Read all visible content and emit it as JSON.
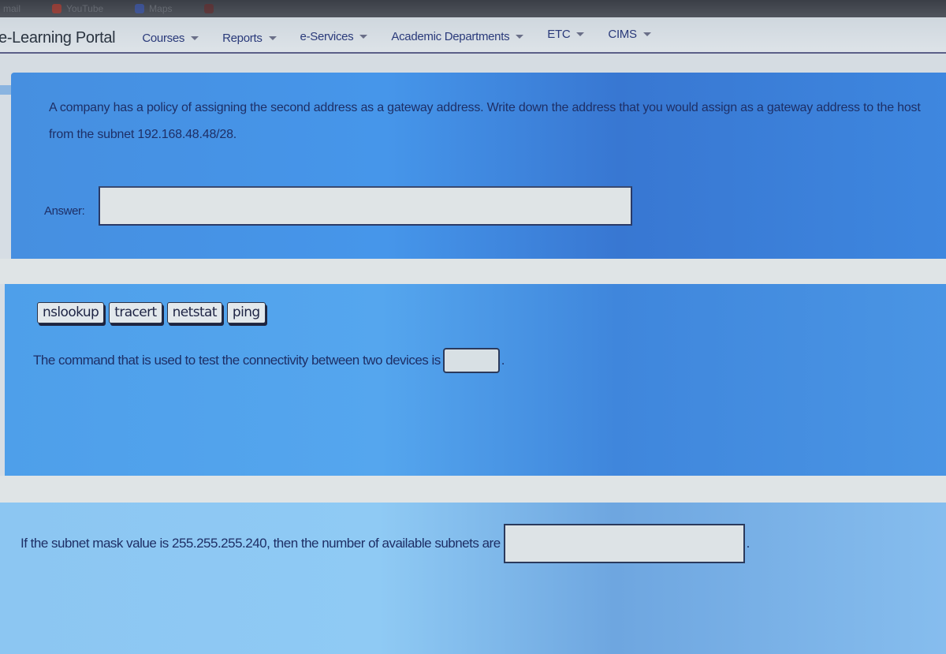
{
  "browser": {
    "bookmarks": [
      {
        "label": "mail",
        "color": "#8a8e96"
      },
      {
        "label": "YouTube",
        "color": "#c63a2a"
      },
      {
        "label": "Maps",
        "color": "#3a5ac0"
      },
      {
        "label": "",
        "color": "#6a2a2a"
      }
    ]
  },
  "navbar": {
    "brand": "e-Learning Portal",
    "items": [
      {
        "label": "Courses"
      },
      {
        "label": "Reports"
      },
      {
        "label": "e-Services"
      },
      {
        "label": "Academic Departments"
      },
      {
        "label": "ETC"
      },
      {
        "label": "CIMS"
      }
    ]
  },
  "question1": {
    "text": "A company has a policy of assigning the second address as a gateway address. Write down the address that you would assign as a gateway address to the host from the subnet 192.168.48.48/28.",
    "answer_label": "Answer:",
    "answer_value": ""
  },
  "question2": {
    "options": [
      "nslookup",
      "tracert",
      "netstat",
      "ping"
    ],
    "text": "The command that is used to test the connectivity between two devices is",
    "drop_value": "",
    "suffix": "."
  },
  "question3": {
    "text": "If the subnet mask value is 255.255.255.240, then the number of available subnets are",
    "answer_value": "",
    "suffix": "."
  }
}
